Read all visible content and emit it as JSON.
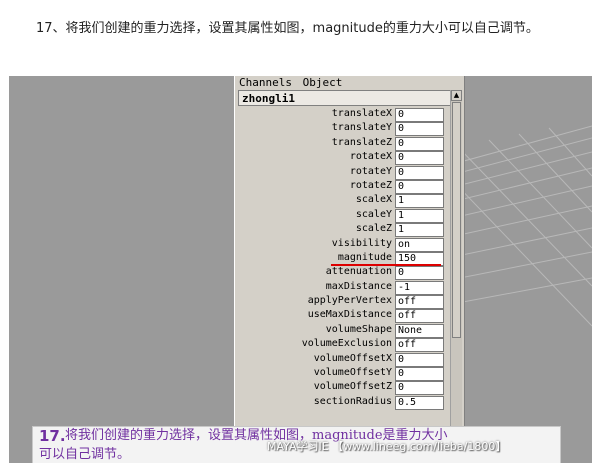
{
  "intro_text": "17、将我们创建的重力选择，设置其属性如图，magnitude的重力大小可以自己调节。",
  "panel": {
    "menu": [
      "Channels",
      "Object"
    ],
    "object_name": "zhongli1",
    "attributes": [
      {
        "label": "translateX",
        "value": "0"
      },
      {
        "label": "translateY",
        "value": "0"
      },
      {
        "label": "translateZ",
        "value": "0"
      },
      {
        "label": "rotateX",
        "value": "0"
      },
      {
        "label": "rotateY",
        "value": "0"
      },
      {
        "label": "rotateZ",
        "value": "0"
      },
      {
        "label": "scaleX",
        "value": "1"
      },
      {
        "label": "scaleY",
        "value": "1"
      },
      {
        "label": "scaleZ",
        "value": "1"
      },
      {
        "label": "visibility",
        "value": "on"
      },
      {
        "label": "magnitude",
        "value": "150"
      },
      {
        "label": "attenuation",
        "value": "0"
      },
      {
        "label": "maxDistance",
        "value": "-1"
      },
      {
        "label": "applyPerVertex",
        "value": "off"
      },
      {
        "label": "useMaxDistance",
        "value": "off"
      },
      {
        "label": "volumeShape",
        "value": "None"
      },
      {
        "label": "volumeExclusion",
        "value": "off"
      },
      {
        "label": "volumeOffsetX",
        "value": "0"
      },
      {
        "label": "volumeOffsetY",
        "value": "0"
      },
      {
        "label": "volumeOffsetZ",
        "value": "0"
      },
      {
        "label": "sectionRadius",
        "value": "0.5"
      }
    ],
    "highlight_color": "#dd0000"
  },
  "caption": {
    "number": "17.",
    "line1": "将我们创建的重力选择，设置其属性如图，magnitude是重力大小",
    "line2": "可以自己调节。",
    "color": "#7030a0"
  },
  "watermark": "MAYA学习IE 【www.lineeg.com/lieba/1800】"
}
